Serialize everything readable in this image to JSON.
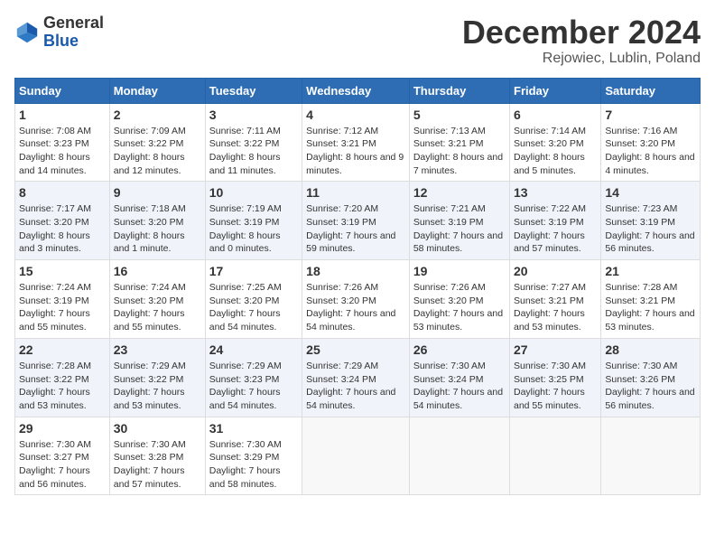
{
  "header": {
    "logo_general": "General",
    "logo_blue": "Blue",
    "month_title": "December 2024",
    "location": "Rejowiec, Lublin, Poland"
  },
  "calendar": {
    "days_of_week": [
      "Sunday",
      "Monday",
      "Tuesday",
      "Wednesday",
      "Thursday",
      "Friday",
      "Saturday"
    ],
    "weeks": [
      [
        {
          "day": "1",
          "sunrise": "Sunrise: 7:08 AM",
          "sunset": "Sunset: 3:23 PM",
          "daylight": "Daylight: 8 hours and 14 minutes."
        },
        {
          "day": "2",
          "sunrise": "Sunrise: 7:09 AM",
          "sunset": "Sunset: 3:22 PM",
          "daylight": "Daylight: 8 hours and 12 minutes."
        },
        {
          "day": "3",
          "sunrise": "Sunrise: 7:11 AM",
          "sunset": "Sunset: 3:22 PM",
          "daylight": "Daylight: 8 hours and 11 minutes."
        },
        {
          "day": "4",
          "sunrise": "Sunrise: 7:12 AM",
          "sunset": "Sunset: 3:21 PM",
          "daylight": "Daylight: 8 hours and 9 minutes."
        },
        {
          "day": "5",
          "sunrise": "Sunrise: 7:13 AM",
          "sunset": "Sunset: 3:21 PM",
          "daylight": "Daylight: 8 hours and 7 minutes."
        },
        {
          "day": "6",
          "sunrise": "Sunrise: 7:14 AM",
          "sunset": "Sunset: 3:20 PM",
          "daylight": "Daylight: 8 hours and 5 minutes."
        },
        {
          "day": "7",
          "sunrise": "Sunrise: 7:16 AM",
          "sunset": "Sunset: 3:20 PM",
          "daylight": "Daylight: 8 hours and 4 minutes."
        }
      ],
      [
        {
          "day": "8",
          "sunrise": "Sunrise: 7:17 AM",
          "sunset": "Sunset: 3:20 PM",
          "daylight": "Daylight: 8 hours and 3 minutes."
        },
        {
          "day": "9",
          "sunrise": "Sunrise: 7:18 AM",
          "sunset": "Sunset: 3:20 PM",
          "daylight": "Daylight: 8 hours and 1 minute."
        },
        {
          "day": "10",
          "sunrise": "Sunrise: 7:19 AM",
          "sunset": "Sunset: 3:19 PM",
          "daylight": "Daylight: 8 hours and 0 minutes."
        },
        {
          "day": "11",
          "sunrise": "Sunrise: 7:20 AM",
          "sunset": "Sunset: 3:19 PM",
          "daylight": "Daylight: 7 hours and 59 minutes."
        },
        {
          "day": "12",
          "sunrise": "Sunrise: 7:21 AM",
          "sunset": "Sunset: 3:19 PM",
          "daylight": "Daylight: 7 hours and 58 minutes."
        },
        {
          "day": "13",
          "sunrise": "Sunrise: 7:22 AM",
          "sunset": "Sunset: 3:19 PM",
          "daylight": "Daylight: 7 hours and 57 minutes."
        },
        {
          "day": "14",
          "sunrise": "Sunrise: 7:23 AM",
          "sunset": "Sunset: 3:19 PM",
          "daylight": "Daylight: 7 hours and 56 minutes."
        }
      ],
      [
        {
          "day": "15",
          "sunrise": "Sunrise: 7:24 AM",
          "sunset": "Sunset: 3:19 PM",
          "daylight": "Daylight: 7 hours and 55 minutes."
        },
        {
          "day": "16",
          "sunrise": "Sunrise: 7:24 AM",
          "sunset": "Sunset: 3:20 PM",
          "daylight": "Daylight: 7 hours and 55 minutes."
        },
        {
          "day": "17",
          "sunrise": "Sunrise: 7:25 AM",
          "sunset": "Sunset: 3:20 PM",
          "daylight": "Daylight: 7 hours and 54 minutes."
        },
        {
          "day": "18",
          "sunrise": "Sunrise: 7:26 AM",
          "sunset": "Sunset: 3:20 PM",
          "daylight": "Daylight: 7 hours and 54 minutes."
        },
        {
          "day": "19",
          "sunrise": "Sunrise: 7:26 AM",
          "sunset": "Sunset: 3:20 PM",
          "daylight": "Daylight: 7 hours and 53 minutes."
        },
        {
          "day": "20",
          "sunrise": "Sunrise: 7:27 AM",
          "sunset": "Sunset: 3:21 PM",
          "daylight": "Daylight: 7 hours and 53 minutes."
        },
        {
          "day": "21",
          "sunrise": "Sunrise: 7:28 AM",
          "sunset": "Sunset: 3:21 PM",
          "daylight": "Daylight: 7 hours and 53 minutes."
        }
      ],
      [
        {
          "day": "22",
          "sunrise": "Sunrise: 7:28 AM",
          "sunset": "Sunset: 3:22 PM",
          "daylight": "Daylight: 7 hours and 53 minutes."
        },
        {
          "day": "23",
          "sunrise": "Sunrise: 7:29 AM",
          "sunset": "Sunset: 3:22 PM",
          "daylight": "Daylight: 7 hours and 53 minutes."
        },
        {
          "day": "24",
          "sunrise": "Sunrise: 7:29 AM",
          "sunset": "Sunset: 3:23 PM",
          "daylight": "Daylight: 7 hours and 54 minutes."
        },
        {
          "day": "25",
          "sunrise": "Sunrise: 7:29 AM",
          "sunset": "Sunset: 3:24 PM",
          "daylight": "Daylight: 7 hours and 54 minutes."
        },
        {
          "day": "26",
          "sunrise": "Sunrise: 7:30 AM",
          "sunset": "Sunset: 3:24 PM",
          "daylight": "Daylight: 7 hours and 54 minutes."
        },
        {
          "day": "27",
          "sunrise": "Sunrise: 7:30 AM",
          "sunset": "Sunset: 3:25 PM",
          "daylight": "Daylight: 7 hours and 55 minutes."
        },
        {
          "day": "28",
          "sunrise": "Sunrise: 7:30 AM",
          "sunset": "Sunset: 3:26 PM",
          "daylight": "Daylight: 7 hours and 56 minutes."
        }
      ],
      [
        {
          "day": "29",
          "sunrise": "Sunrise: 7:30 AM",
          "sunset": "Sunset: 3:27 PM",
          "daylight": "Daylight: 7 hours and 56 minutes."
        },
        {
          "day": "30",
          "sunrise": "Sunrise: 7:30 AM",
          "sunset": "Sunset: 3:28 PM",
          "daylight": "Daylight: 7 hours and 57 minutes."
        },
        {
          "day": "31",
          "sunrise": "Sunrise: 7:30 AM",
          "sunset": "Sunset: 3:29 PM",
          "daylight": "Daylight: 7 hours and 58 minutes."
        },
        null,
        null,
        null,
        null
      ]
    ]
  }
}
